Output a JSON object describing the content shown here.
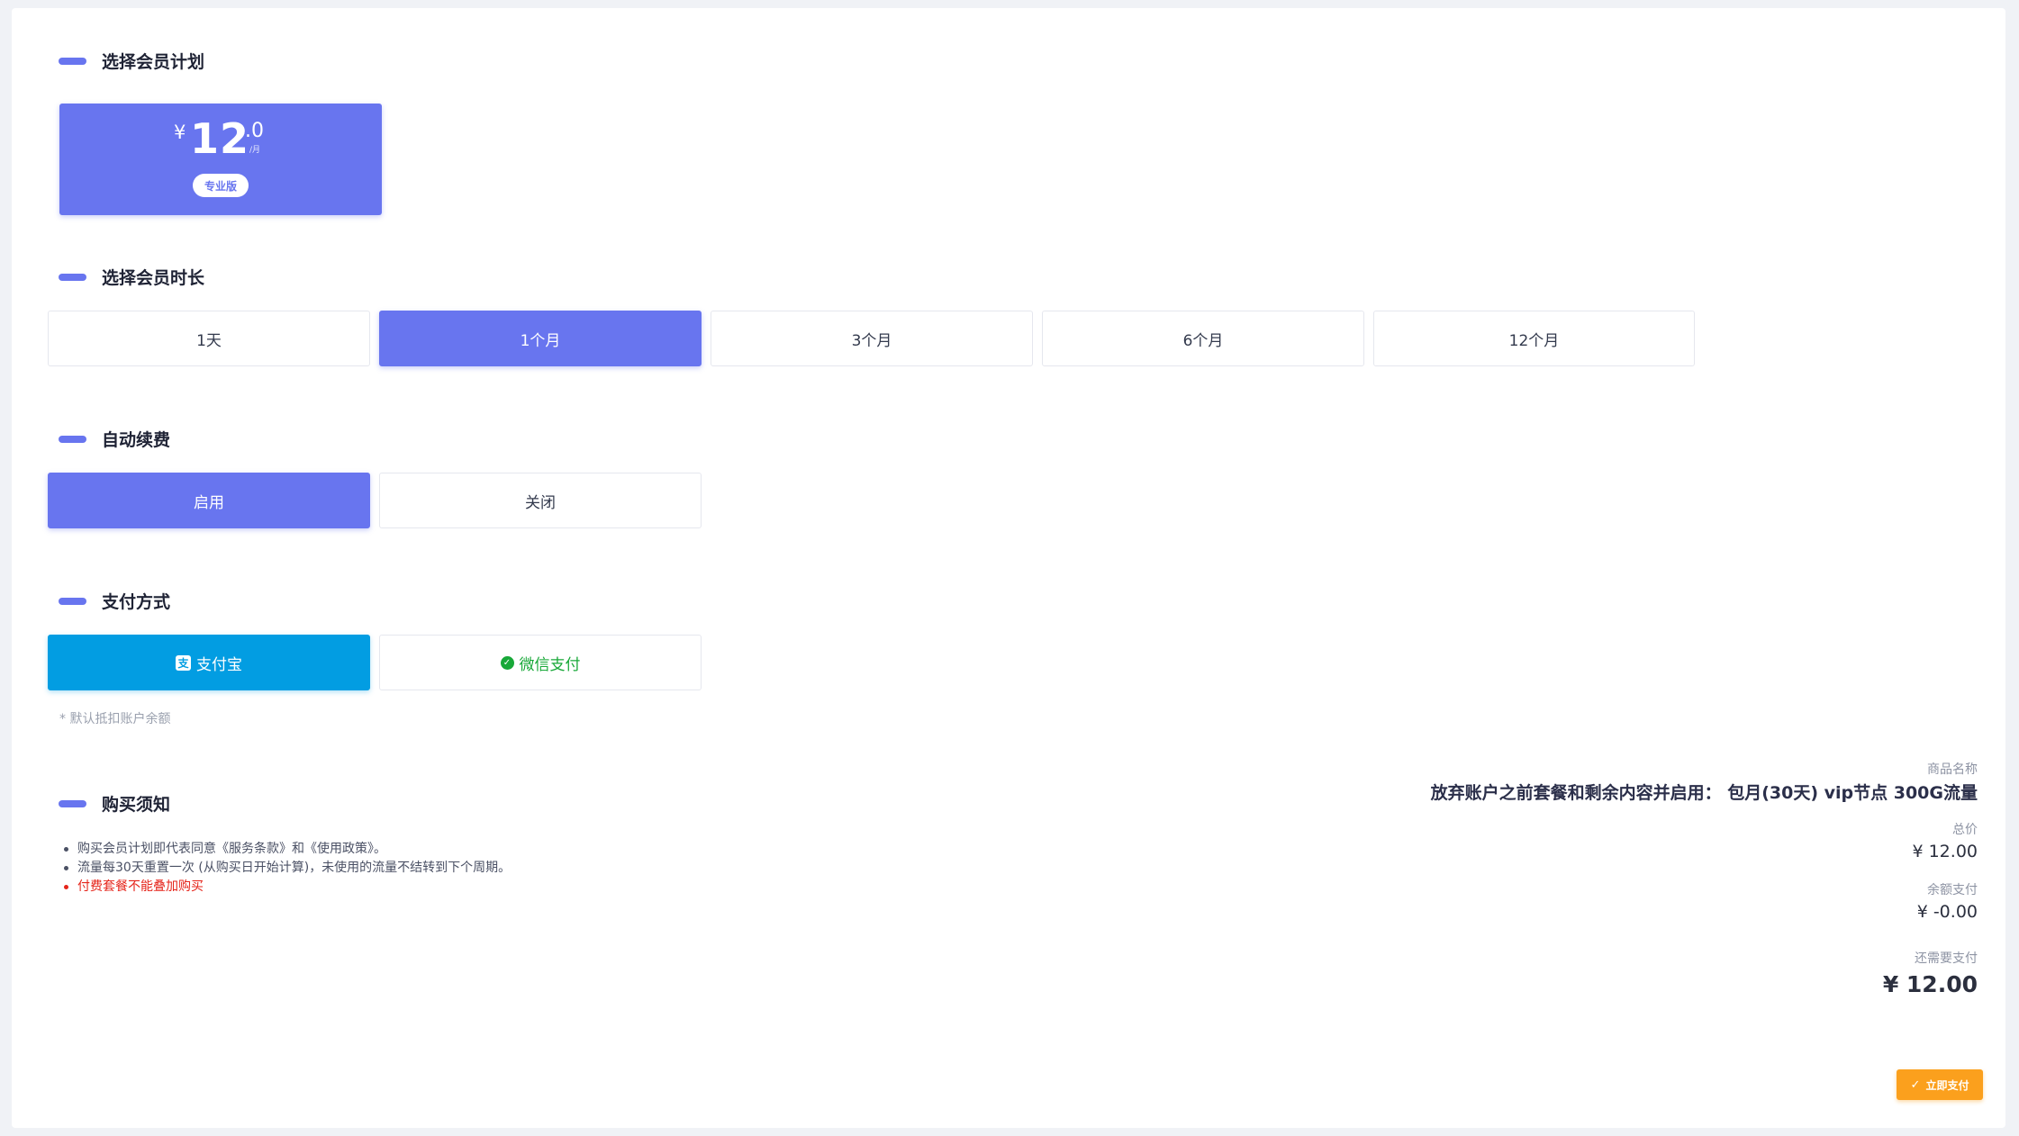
{
  "sections": {
    "plan": "选择会员计划",
    "duration": "选择会员时长",
    "auto_renew": "自动续费",
    "payment": "支付方式",
    "notice": "购买须知"
  },
  "plan_card": {
    "currency": "¥",
    "price_int": "12",
    "price_dec": ".0",
    "unit": "/月",
    "badge": "专业版"
  },
  "durations": [
    "1天",
    "1个月",
    "3个月",
    "6个月",
    "12个月"
  ],
  "selected_duration": "1个月",
  "auto_renew": {
    "on": "启用",
    "off": "关闭",
    "selected": "启用"
  },
  "payment": {
    "alipay": "支付宝",
    "wechat": "微信支付",
    "selected": "支付宝",
    "alipay_icon": "alipay-icon",
    "wechat_icon": "wechat-icon",
    "hint": "* 默认抵扣账户余额"
  },
  "notices": [
    "购买会员计划即代表同意《服务条款》和《使用政策》。",
    "流量每30天重置一次 (从购买日开始计算)，未使用的流量不结转到下个周期。",
    "付费套餐不能叠加购买"
  ],
  "summary": {
    "product_label": "商品名称",
    "product_name": "放弃账户之前套餐和剩余内容并启用： 包月(30天) vip节点 300G流量",
    "total_label": "总价",
    "total_value": "¥ 12.00",
    "balance_label": "余额支付",
    "balance_value": "¥ -0.00",
    "due_label": "还需要支付",
    "due_value": "¥ 12.00"
  },
  "pay_button": "立即支付",
  "colors": {
    "accent": "#6875ef",
    "alipay": "#029de2",
    "wechat": "#18a838",
    "pay_button": "#fba01d",
    "warning_text": "#e5241a"
  }
}
